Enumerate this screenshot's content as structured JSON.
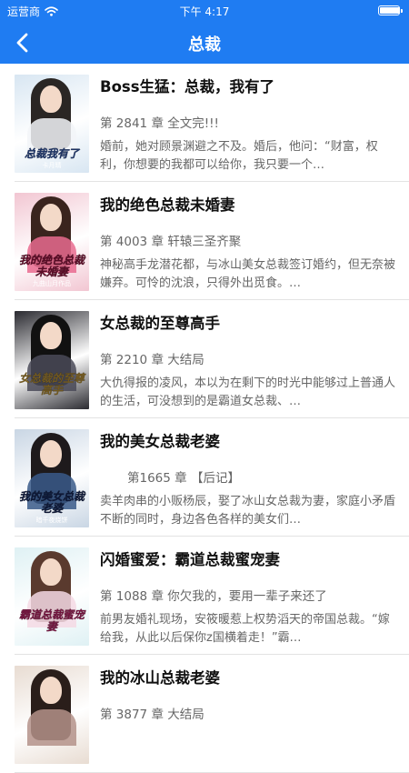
{
  "status_bar": {
    "carrier": "运营商",
    "time": "下午 4:17",
    "battery_level": 1.0
  },
  "nav": {
    "title": "总裁"
  },
  "colors": {
    "nav_bg": "#1f7cf2"
  },
  "books": [
    {
      "title": "Boss生猛：总裁，我有了",
      "chapter": "第 2841 章 全文完!!!",
      "desc": "婚前，她对顾景渊避之不及。婚后，他问：“财富，权利，你想要的我都可以给你，我只要一个…",
      "cover": {
        "title": "总裁我有了",
        "author": "卡月晴",
        "bg": "#d8e6f2",
        "hair": "#2a2624",
        "body": "#f2f4f8",
        "text": "#3a66c8"
      }
    },
    {
      "title": "我的绝色总裁未婚妻",
      "chapter": "第 4003 章 轩辕三圣齐聚",
      "desc": "神秘高手龙潜花都，与冰山美女总裁签订婚约，但无奈被嫌弃。可怜的沈浪，只得外出觅食。…",
      "cover": {
        "title": "我的绝色总裁未婚妻",
        "author": "九曲山月作品",
        "bg": "#f2c6d2",
        "hair": "#3a241e",
        "body": "#e96b8f",
        "text": "#b0174a"
      }
    },
    {
      "title": "女总裁的至尊高手",
      "chapter": "第 2210 章 大结局",
      "desc": "大仇得报的凌风，本以为在剩下的时光中能够过上普通人的生活，可没想到的是霸道女总裁、…",
      "cover": {
        "title": "女总裁的至尊高手",
        "author": "",
        "bg": "#2a2a30",
        "hair": "#111111",
        "body": "#4a4a58",
        "text": "#e0b040"
      }
    },
    {
      "title": "我的美女总裁老婆",
      "chapter": "第1665 章 【后记】",
      "desc": "卖羊肉串的小贩杨辰，娶了冰山女总裁为妻，家庭小矛盾不断的同时，身边各色各样的美女们…",
      "cover": {
        "title": "我的美女总裁老婆",
        "author": "暗千夜烧饼",
        "bg": "#c9d6e4",
        "hair": "#1e1a1c",
        "body": "#3a5a8a",
        "text": "#1a2f6a"
      }
    },
    {
      "title": "闪婚蜜爱：霸道总裁蜜宠妻",
      "chapter": "第 1088 章 你欠我的，要用一辈子来还了",
      "desc": "前男友婚礼现场，安筱暖惹上权势滔天的帝国总裁。“嫁给我，从此以后保你z国横着走！”霸…",
      "cover": {
        "title": "霸道总裁蜜宠妻",
        "author": "",
        "bg": "#dff1f4",
        "hair": "#5a3a2e",
        "body": "#f5d9e4",
        "text": "#e0287a"
      }
    },
    {
      "title": "我的冰山总裁老婆",
      "chapter": "第 3877 章 大结局",
      "desc": "",
      "cover": {
        "title": "",
        "author": "",
        "bg": "#e8dcd2",
        "hair": "#2a1e1a",
        "body": "#b4928a",
        "text": "#333333"
      }
    }
  ]
}
